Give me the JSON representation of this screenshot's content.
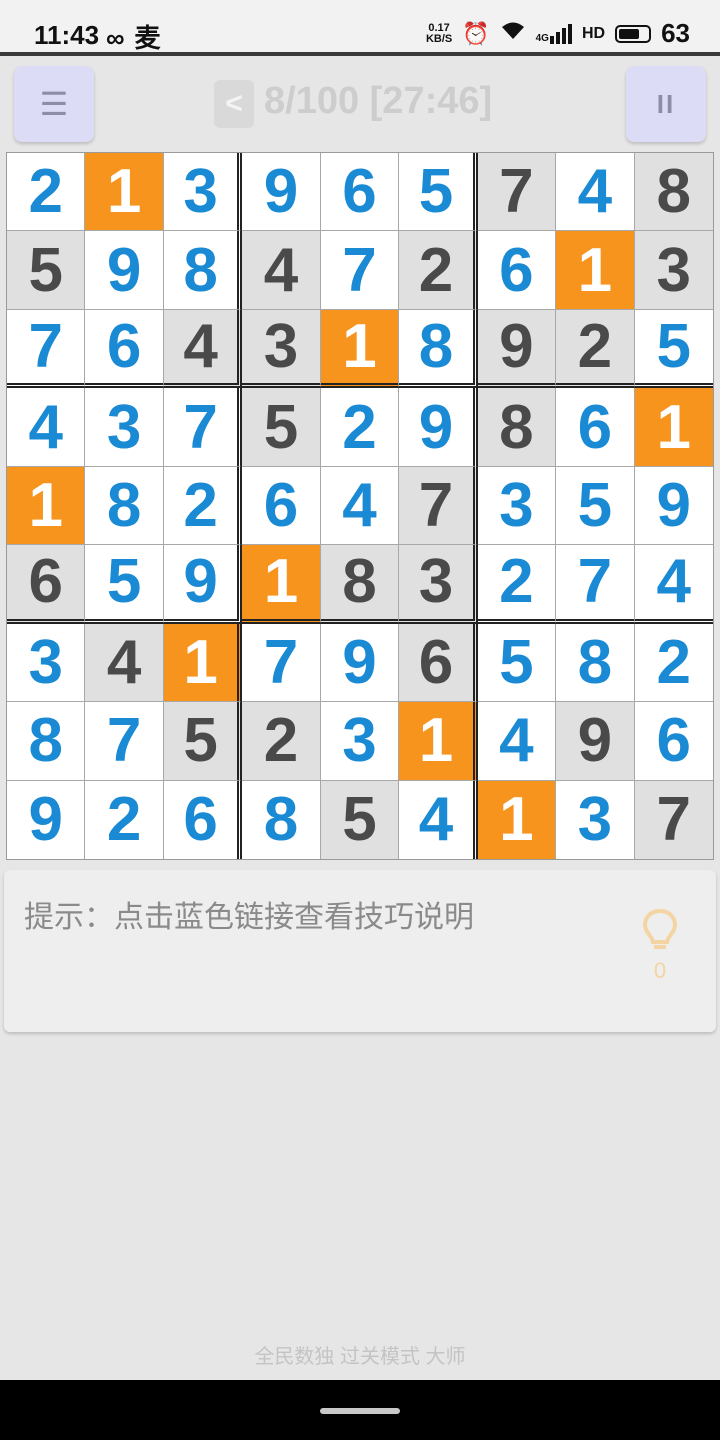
{
  "status_bar": {
    "time": "11:43",
    "left_icons": [
      "infinity-icon",
      "app-notification-icon"
    ],
    "speed_value": "0.17",
    "speed_unit": "KB/S",
    "network_label": "4G",
    "hd_label": "HD",
    "battery": "63"
  },
  "header": {
    "back_label": "<",
    "progress": "8/100 [27:46]"
  },
  "board": {
    "rows": [
      [
        "2",
        "1",
        "3",
        "9",
        "6",
        "5",
        "7",
        "4",
        "8"
      ],
      [
        "5",
        "9",
        "8",
        "4",
        "7",
        "2",
        "6",
        "1",
        "3"
      ],
      [
        "7",
        "6",
        "4",
        "3",
        "1",
        "8",
        "9",
        "2",
        "5"
      ],
      [
        "4",
        "3",
        "7",
        "5",
        "2",
        "9",
        "8",
        "6",
        "1"
      ],
      [
        "1",
        "8",
        "2",
        "6",
        "4",
        "7",
        "3",
        "5",
        "9"
      ],
      [
        "6",
        "5",
        "9",
        "1",
        "8",
        "3",
        "2",
        "7",
        "4"
      ],
      [
        "3",
        "4",
        "1",
        "7",
        "9",
        "6",
        "5",
        "8",
        "2"
      ],
      [
        "8",
        "7",
        "5",
        "2",
        "3",
        "1",
        "4",
        "9",
        "6"
      ],
      [
        "9",
        "2",
        "6",
        "8",
        "5",
        "4",
        "1",
        "3",
        "7"
      ]
    ],
    "states": [
      [
        "f",
        "h",
        "f",
        "f",
        "f",
        "f",
        "g",
        "f",
        "g"
      ],
      [
        "g",
        "f",
        "f",
        "g",
        "f",
        "g",
        "f",
        "h",
        "g"
      ],
      [
        "f",
        "f",
        "g",
        "g",
        "h",
        "f",
        "g",
        "g",
        "f"
      ],
      [
        "f",
        "f",
        "f",
        "g",
        "f",
        "f",
        "g",
        "f",
        "h"
      ],
      [
        "h",
        "f",
        "f",
        "f",
        "f",
        "g",
        "f",
        "f",
        "f"
      ],
      [
        "g",
        "f",
        "f",
        "h",
        "g",
        "g",
        "f",
        "f",
        "f"
      ],
      [
        "f",
        "g",
        "h",
        "f",
        "f",
        "g",
        "f",
        "f",
        "f"
      ],
      [
        "f",
        "f",
        "g",
        "g",
        "f",
        "h",
        "f",
        "g",
        "f"
      ],
      [
        "f",
        "f",
        "f",
        "f",
        "g",
        "f",
        "h",
        "f",
        "g"
      ]
    ],
    "colors": {
      "given_bg": "#e0e0e0",
      "given_text": "#4a4a4a",
      "filled_bg": "#ffffff",
      "filled_text": "#1a8ad4",
      "highlight_bg": "#f7941e",
      "highlight_text": "#ffffff"
    }
  },
  "hint": {
    "text": "提示：点击蓝色链接查看技巧说明",
    "count": "0"
  },
  "footer": {
    "text": "全民数独 过关模式 大师"
  }
}
